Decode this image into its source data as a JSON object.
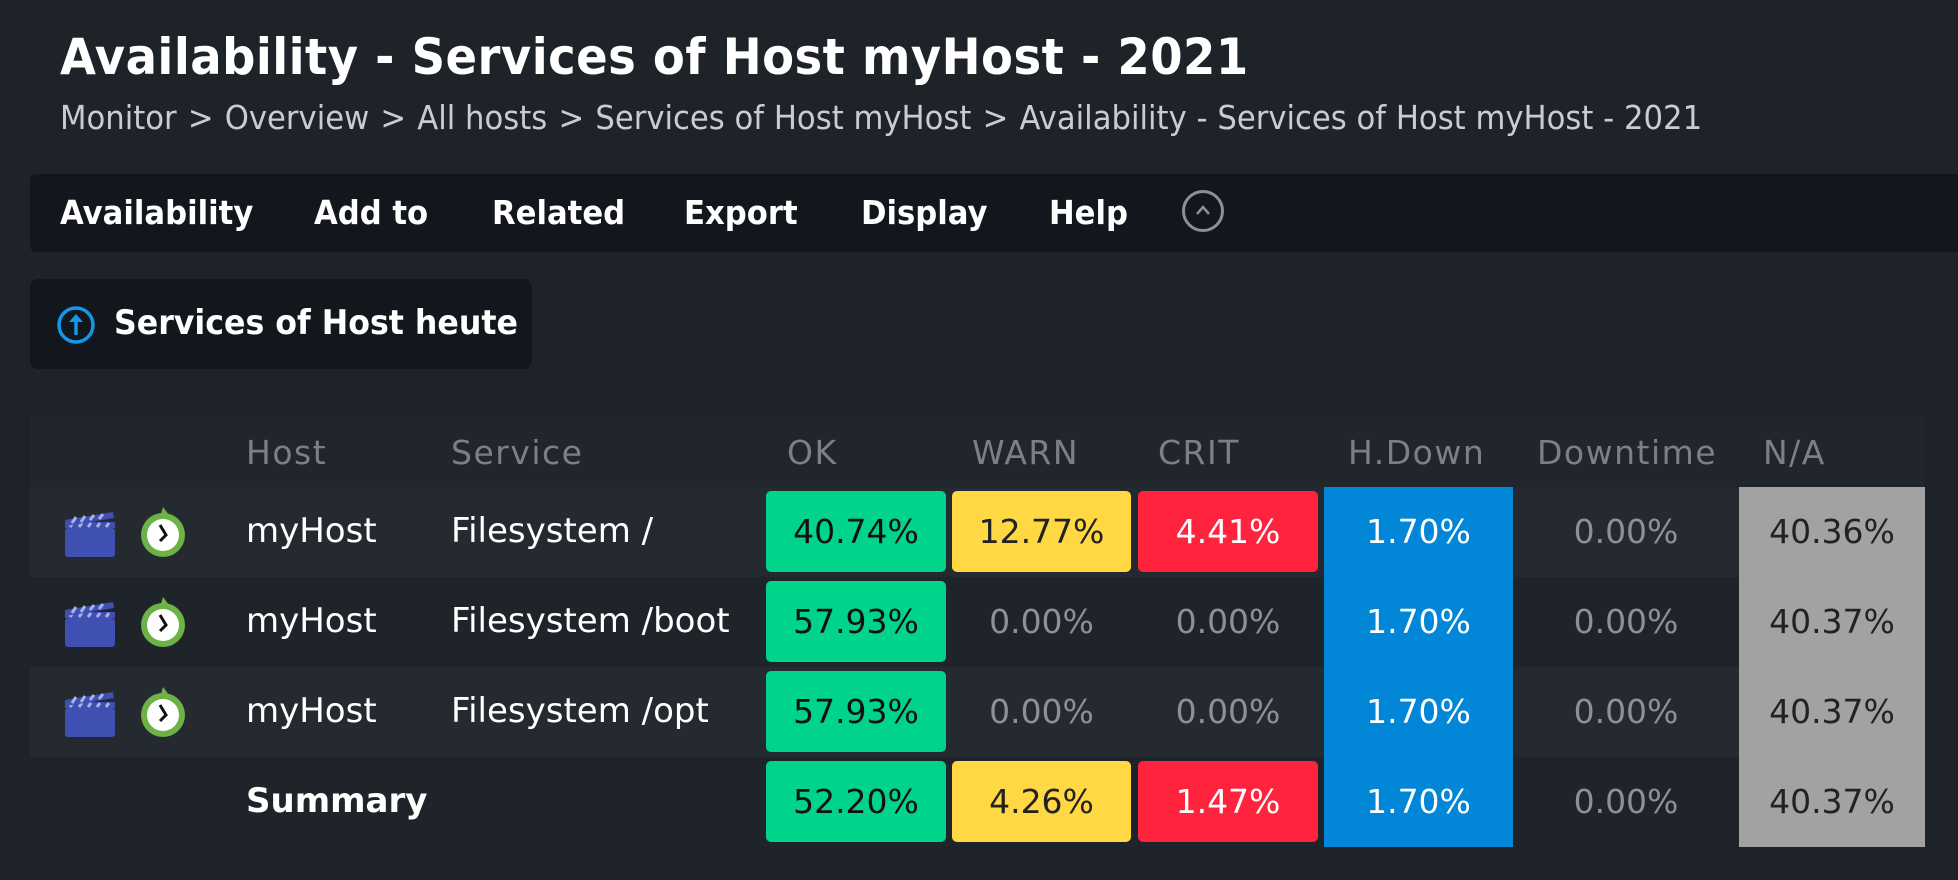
{
  "page": {
    "title": "Availability - Services of Host myHost - 2021",
    "breadcrumb": [
      "Monitor",
      "Overview",
      "All hosts",
      "Services of Host myHost",
      "Availability - Services of Host myHost - 2021"
    ],
    "breadcrumb_separator": ">"
  },
  "menubar": {
    "items": [
      {
        "label": "Availability"
      },
      {
        "label": "Add to"
      },
      {
        "label": "Related"
      },
      {
        "label": "Export"
      },
      {
        "label": "Display"
      },
      {
        "label": "Help"
      }
    ],
    "collapse_icon": "chevron-up-circle-icon"
  },
  "context_button": {
    "label": "Services of Host heute",
    "icon": "arrow-up-circle-icon"
  },
  "colors": {
    "ok": "#00d48b",
    "warn": "#ffd843",
    "crit": "#ff233d",
    "host_down": "#0186d8",
    "na": "#a2a2a2",
    "background": "#1e232a"
  },
  "table": {
    "columns": [
      "Host",
      "Service",
      "OK",
      "WARN",
      "CRIT",
      "H.Down",
      "Downtime",
      "N/A"
    ],
    "rows": [
      {
        "icons": [
          "timeline-icon",
          "availability-clock-icon"
        ],
        "host": "myHost",
        "service": "Filesystem /",
        "ok": "40.74%",
        "warn": "12.77%",
        "crit": "4.41%",
        "hdown": "1.70%",
        "downtime": "0.00%",
        "na": "40.36%"
      },
      {
        "icons": [
          "timeline-icon",
          "availability-clock-icon"
        ],
        "host": "myHost",
        "service": "Filesystem /boot",
        "ok": "57.93%",
        "warn": "0.00%",
        "crit": "0.00%",
        "hdown": "1.70%",
        "downtime": "0.00%",
        "na": "40.37%"
      },
      {
        "icons": [
          "timeline-icon",
          "availability-clock-icon"
        ],
        "host": "myHost",
        "service": "Filesystem /opt",
        "ok": "57.93%",
        "warn": "0.00%",
        "crit": "0.00%",
        "hdown": "1.70%",
        "downtime": "0.00%",
        "na": "40.37%"
      }
    ],
    "summary": {
      "label": "Summary",
      "ok": "52.20%",
      "warn": "4.26%",
      "crit": "1.47%",
      "hdown": "1.70%",
      "downtime": "0.00%",
      "na": "40.37%"
    }
  }
}
